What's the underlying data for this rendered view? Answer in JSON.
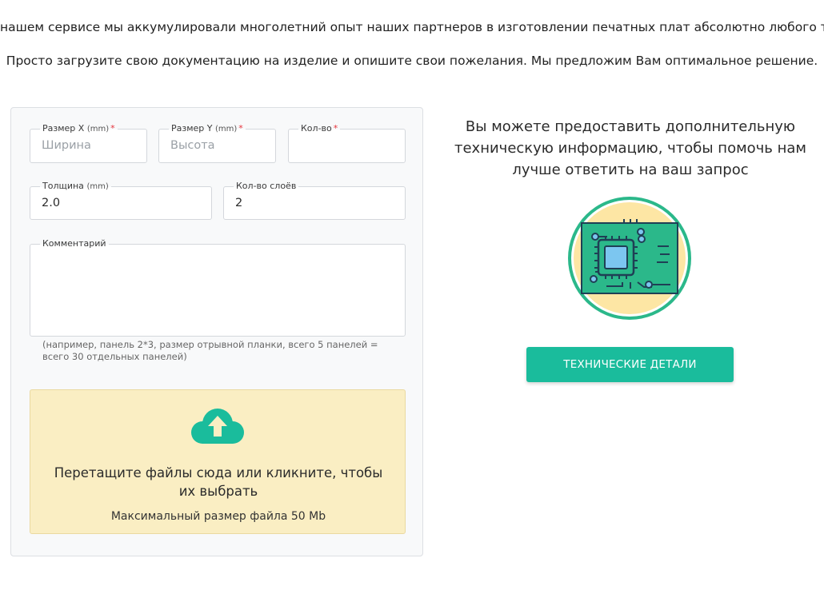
{
  "intro": {
    "line1": "нашем сервисе мы аккумулировали многолетний опыт наших партнеров в изготовлении печатных плат абсолютно любого типа.",
    "line2": "Просто загрузите свою документацию на изделие и опишите свои пожелания. Мы предложим Вам оптимальное решение."
  },
  "form": {
    "size_x": {
      "label": "Размер X",
      "unit": "(mm)",
      "required": "*",
      "placeholder": "Ширина",
      "value": ""
    },
    "size_y": {
      "label": "Размер Y",
      "unit": "(mm)",
      "required": "*",
      "placeholder": "Высота",
      "value": ""
    },
    "quantity": {
      "label": "Кол-во",
      "required": "*",
      "value": ""
    },
    "thickness": {
      "label": "Толщина",
      "unit": "(mm)",
      "value": "2.0"
    },
    "layers": {
      "label": "Кол-во слоёв",
      "value": "2"
    },
    "comment": {
      "label": "Комментарий",
      "value": ""
    },
    "hint": "(например, панель 2*3, размер отрывной планки, всего 5 панелей = всего 30 отдельных панелей)",
    "dropzone": {
      "text": "Перетащите файлы сюда или кликните, чтобы их выбрать",
      "max_size": "Максимальный размер файла 50 Mb",
      "icon": "cloud-upload-icon"
    }
  },
  "info": {
    "text": "Вы можете предоставить дополнительную техническую информацию, чтобы помочь нам лучше ответить на ваш запрос",
    "illustration": "pcb-chip-icon",
    "button_label": "ТЕХНИЧЕСКИЕ ДЕТАЛИ"
  },
  "colors": {
    "accent": "#1abc9c",
    "dropzone_bg": "#faeec3",
    "required": "#e5333b",
    "pcb_green": "#2bb88a",
    "pcb_chip": "#7cc6f0"
  }
}
